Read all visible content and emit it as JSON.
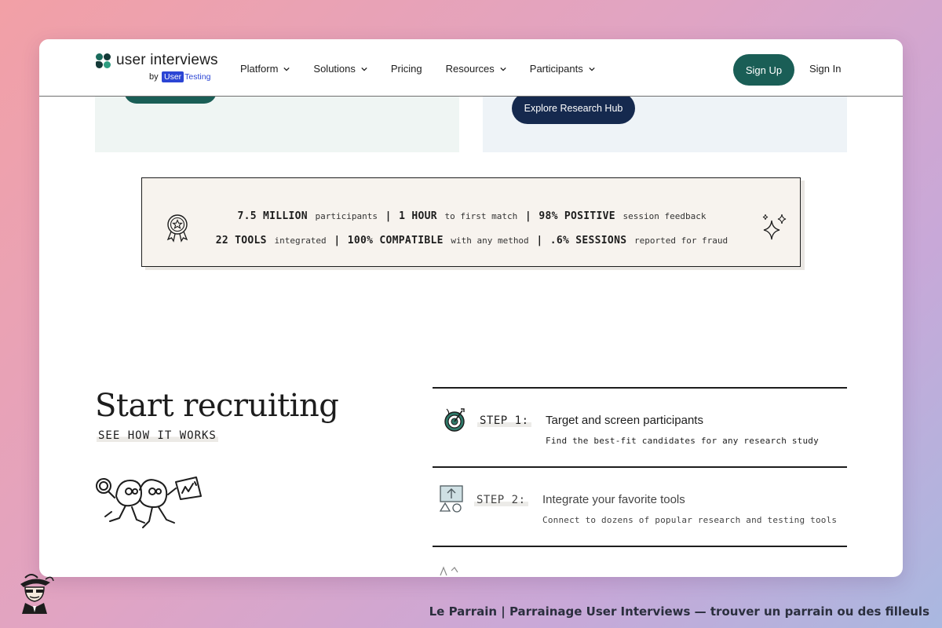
{
  "logo": {
    "name": "user interviews",
    "by": "by",
    "partner_user": "User",
    "partner_testing": "Testing"
  },
  "nav": {
    "items": [
      {
        "label": "Platform",
        "has_dropdown": true
      },
      {
        "label": "Solutions",
        "has_dropdown": true
      },
      {
        "label": "Pricing",
        "has_dropdown": false
      },
      {
        "label": "Resources",
        "has_dropdown": true
      },
      {
        "label": "Participants",
        "has_dropdown": true
      }
    ],
    "signup_label": "Sign Up",
    "signin_label": "Sign In"
  },
  "hub_button": "Explore Research Hub",
  "stats": {
    "row1": [
      {
        "value": "7.5 MILLION",
        "text": "participants"
      },
      {
        "value": "1 HOUR",
        "text": "to first match"
      },
      {
        "value": "98% POSITIVE",
        "text": "session feedback"
      }
    ],
    "row2": [
      {
        "value": "22 TOOLS",
        "text": "integrated"
      },
      {
        "value": "100% COMPATIBLE",
        "text": "with any method"
      },
      {
        "value": ".6% SESSIONS",
        "text": "reported for fraud"
      }
    ],
    "separator": "|"
  },
  "recruiting": {
    "title": "Start recruiting",
    "subtitle": "SEE HOW IT WORKS"
  },
  "steps": [
    {
      "label": "STEP 1:",
      "title": "Target and screen participants",
      "description": "Find the best-fit candidates for any research study",
      "icon": "target-icon"
    },
    {
      "label": "STEP 2:",
      "title": "Integrate your favorite tools",
      "description": "Connect to dozens of popular research and testing tools",
      "icon": "tools-icon"
    }
  ],
  "footer": {
    "text": "Le Parrain | Parrainage User Interviews — trouver un parrain ou des filleuls"
  },
  "colors": {
    "brand_green": "#1a5e56",
    "hub_navy": "#15294e",
    "usertesting_blue": "#2b45d4"
  }
}
